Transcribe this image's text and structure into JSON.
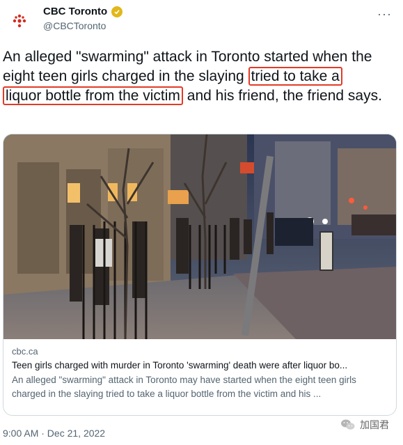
{
  "account": {
    "name": "CBC Toronto",
    "handle": "@CBCToronto",
    "avatar_text": "CBC\nTORONTO",
    "verified_color": "#e2b719"
  },
  "tweet": {
    "part1": "An alleged \"swarming\" attack in Toronto started when the eight teen girls charged in the slaying ",
    "highlight1": "tried to take a",
    "highlight2": "liquor bottle from the victim",
    "part2": " and his friend, the friend says."
  },
  "card": {
    "domain": "cbc.ca",
    "title": "Teen girls charged with murder in Toronto 'swarming' death were after liquor bo...",
    "description": "An alleged \"swarming\" attack in Toronto may have started when the eight teen girls charged in the slaying tried to take a liquor bottle from the victim and his ..."
  },
  "timestamp": "9:00 AM · Dec 21, 2022",
  "watermark": "加国君",
  "colors": {
    "highlight_border": "#e33a26",
    "brand": "#d52b1e"
  }
}
